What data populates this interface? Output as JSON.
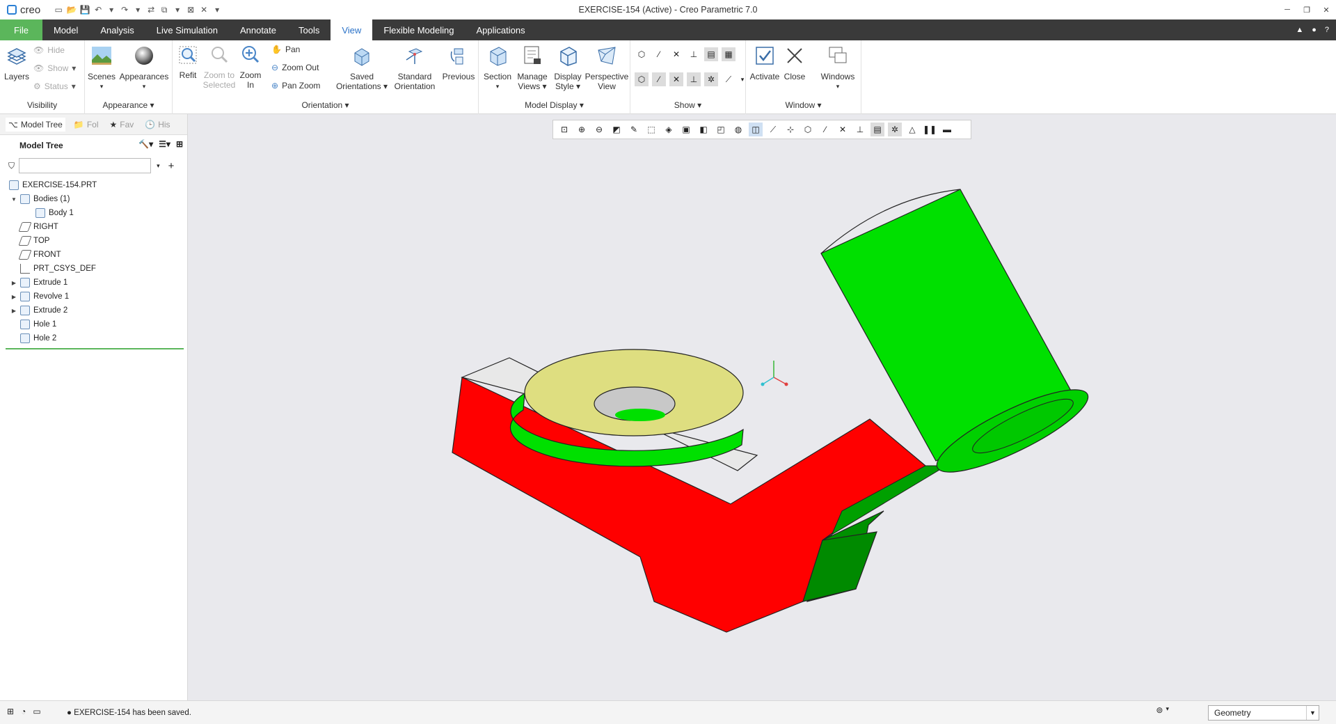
{
  "window": {
    "title": "EXERCISE-154 (Active) - Creo Parametric 7.0",
    "logo": "creo"
  },
  "menu_tabs": [
    {
      "label": "File"
    },
    {
      "label": "Model"
    },
    {
      "label": "Analysis"
    },
    {
      "label": "Live Simulation"
    },
    {
      "label": "Annotate"
    },
    {
      "label": "Tools"
    },
    {
      "label": "View"
    },
    {
      "label": "Flexible Modeling"
    },
    {
      "label": "Applications"
    }
  ],
  "ribbon": {
    "visibility": {
      "label": "Visibility",
      "layers": "Layers",
      "hide": "Hide",
      "show": "Show",
      "status": "Status"
    },
    "appearance": {
      "label": "Appearance",
      "scenes": "Scenes",
      "appearances": "Appearances"
    },
    "orientation": {
      "label": "Orientation",
      "refit": "Refit",
      "zoom_selected_1": "Zoom to",
      "zoom_selected_2": "Selected",
      "zoom_in_1": "Zoom",
      "zoom_in_2": "In",
      "pan": "Pan",
      "zoom_out": "Zoom Out",
      "pan_zoom": "Pan Zoom",
      "saved_1": "Saved",
      "saved_2": "Orientations",
      "standard_1": "Standard",
      "standard_2": "Orientation",
      "previous": "Previous"
    },
    "model_display": {
      "label": "Model Display",
      "section": "Section",
      "manage_1": "Manage",
      "manage_2": "Views",
      "display_1": "Display",
      "display_2": "Style",
      "perspective_1": "Perspective",
      "perspective_2": "View"
    },
    "show": {
      "label": "Show"
    },
    "window": {
      "label": "Window",
      "activate": "Activate",
      "close": "Close",
      "windows": "Windows"
    }
  },
  "left_pane": {
    "tabs": [
      "Model Tree",
      "Fol",
      "Fav",
      "His"
    ],
    "tree_title": "Model Tree",
    "filter_placeholder": "",
    "items": [
      {
        "label": "EXERCISE-154.PRT"
      },
      {
        "label": "Bodies (1)"
      },
      {
        "label": "Body 1"
      },
      {
        "label": "RIGHT"
      },
      {
        "label": "TOP"
      },
      {
        "label": "FRONT"
      },
      {
        "label": "PRT_CSYS_DEF"
      },
      {
        "label": "Extrude 1"
      },
      {
        "label": "Revolve 1"
      },
      {
        "label": "Extrude 2"
      },
      {
        "label": "Hole 1"
      },
      {
        "label": "Hole 2"
      }
    ]
  },
  "status": {
    "message": "EXERCISE-154 has been saved.",
    "selection_filter": "Geometry"
  },
  "colors": {
    "accent": "#5bb65b",
    "tab_active": "#2a72c8",
    "red_body": "#ff0000",
    "green_body": "#00e000",
    "yellow_face": "#dede80",
    "viewport_bg": "#e9e9ed"
  }
}
